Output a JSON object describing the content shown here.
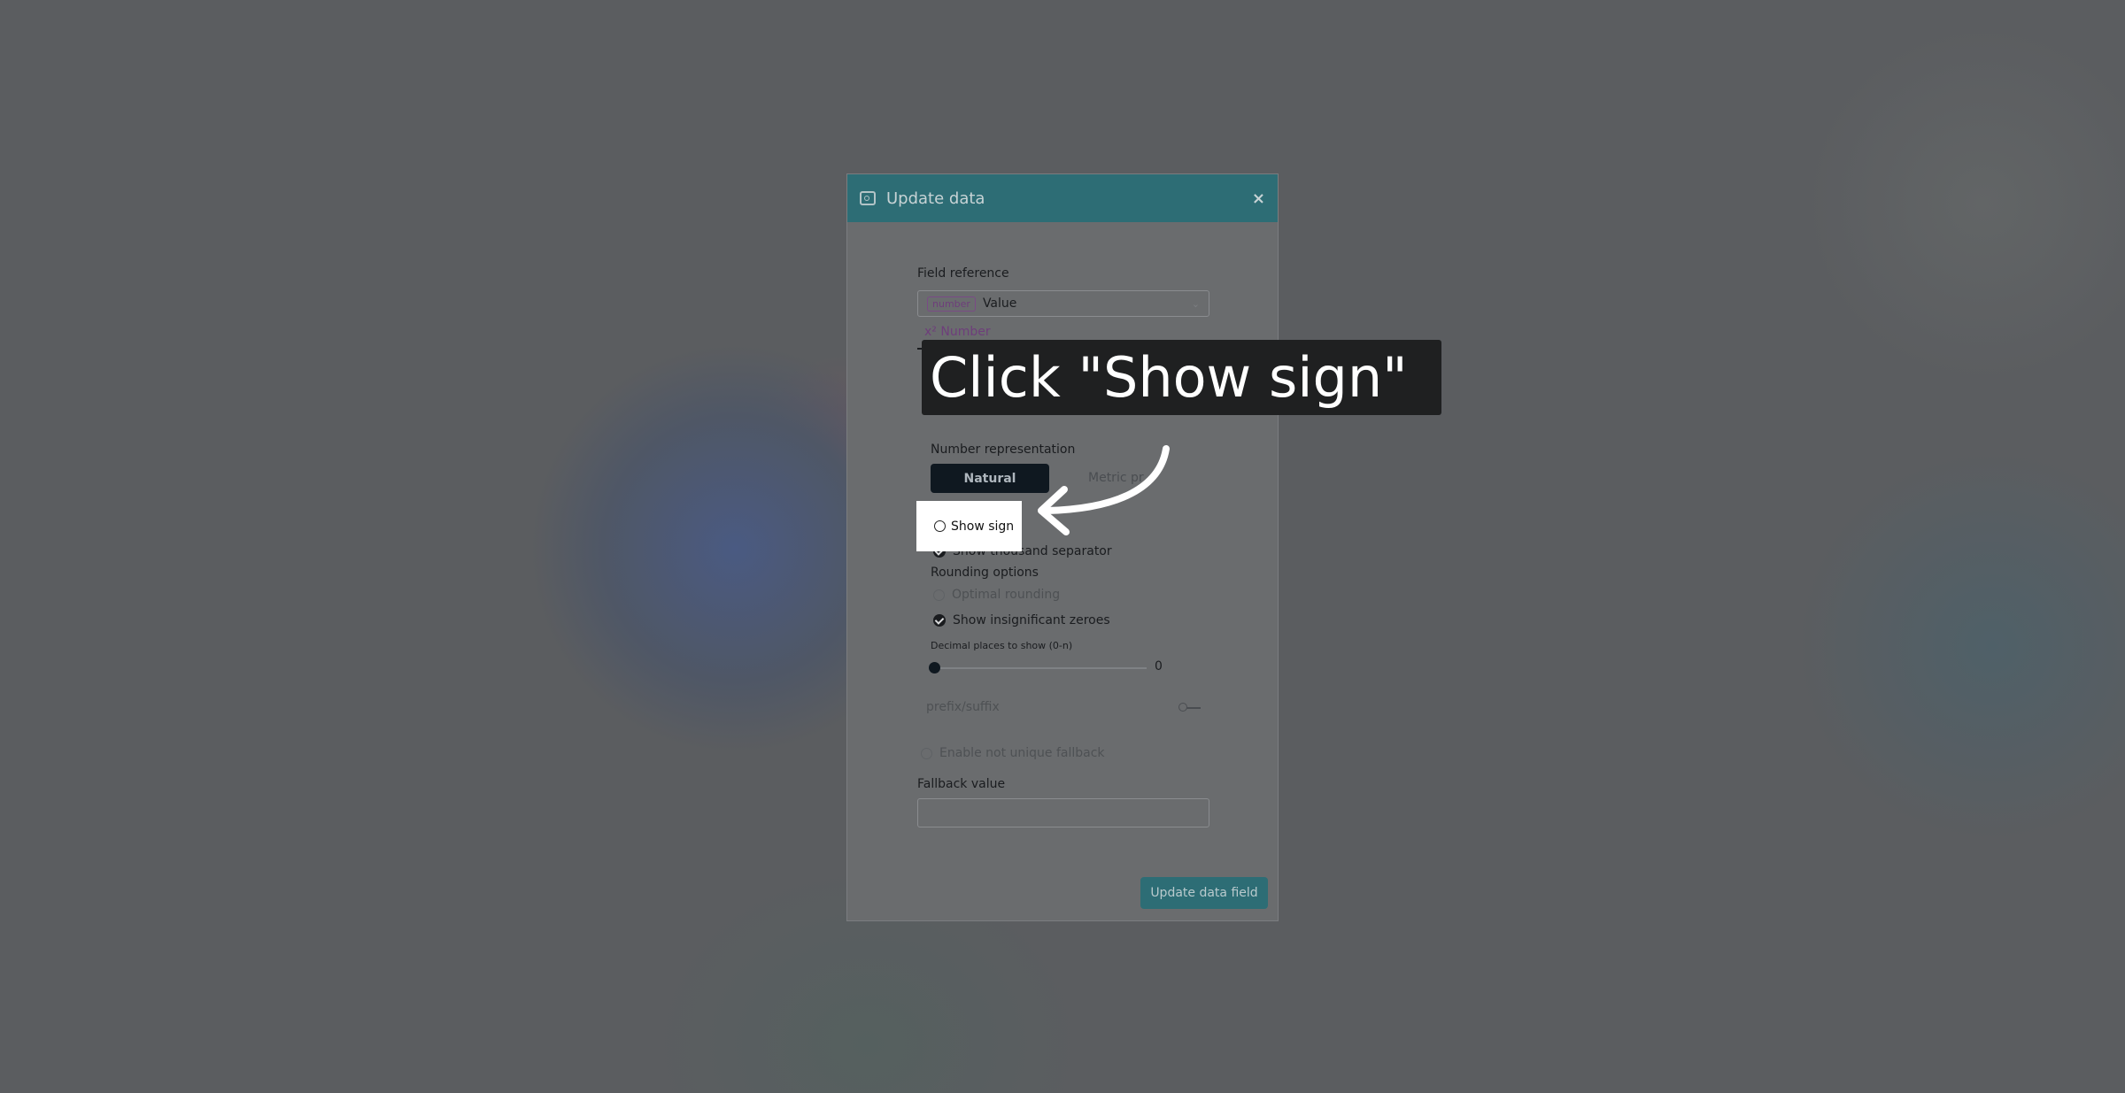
{
  "dialog": {
    "title": "Update data",
    "close_label": "×",
    "field_reference_label": "Field reference",
    "field_select": {
      "badge": "number",
      "value": "Value"
    },
    "tab": {
      "icon": "x²",
      "label": "Number"
    },
    "number_representation_label": "Number representation",
    "representation": {
      "natural": "Natural",
      "metric": "Metric pr"
    },
    "display_options": {
      "show_sign": "Show sign",
      "show_thousand_separator": "Show thousand separator"
    },
    "rounding_label": "Rounding options",
    "rounding": {
      "optimal": "Optimal rounding",
      "insignificant_zeroes": "Show insignificant zeroes"
    },
    "decimal_label": "Decimal places to show (0-n)",
    "decimal_value": "0",
    "prefix_suffix_label": "prefix/suffix",
    "not_unique_fallback": "Enable not unique fallback",
    "fallback_value_label": "Fallback value",
    "fallback_value": "",
    "update_button": "Update data field"
  },
  "tutorial": {
    "instruction": "Click \"Show sign\"",
    "target_label": "Show sign"
  }
}
